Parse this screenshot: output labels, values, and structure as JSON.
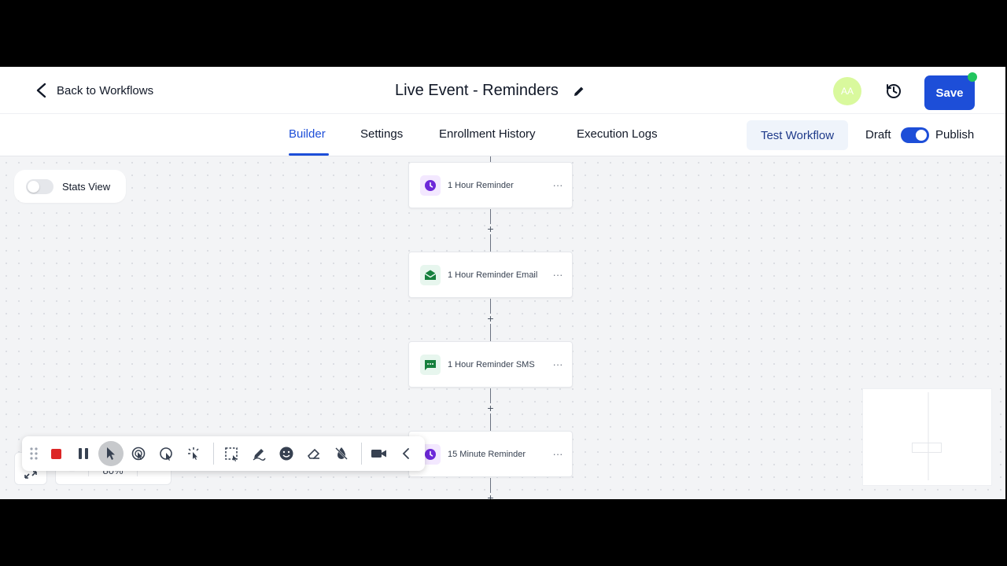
{
  "header": {
    "back_label": "Back to Workflows",
    "title": "Live Event - Reminders",
    "avatar_initials": "AA",
    "save_label": "Save"
  },
  "tabs": [
    {
      "label": "Builder",
      "active": true
    },
    {
      "label": "Settings",
      "active": false
    },
    {
      "label": "Enrollment History",
      "active": false
    },
    {
      "label": "Execution Logs",
      "active": false
    }
  ],
  "actions": {
    "test_label": "Test Workflow",
    "draft_label": "Draft",
    "publish_label": "Publish",
    "publish_on": true
  },
  "canvas": {
    "stats_label": "Stats View",
    "nodes": [
      {
        "label": "1 Hour Reminder",
        "icon": "clock-icon"
      },
      {
        "label": "1 Hour Reminder Email",
        "icon": "email-icon"
      },
      {
        "label": "1 Hour Reminder SMS",
        "icon": "sms-icon"
      },
      {
        "label": "15 Minute Reminder",
        "icon": "clock-icon"
      }
    ],
    "more_glyph": "···",
    "plus_glyph": "+"
  },
  "zoom": {
    "value_partial": "80%"
  },
  "colors": {
    "accent": "#1d4ed8",
    "wait_icon": "#6d28d9",
    "message_icon": "#15803d",
    "online_dot": "#22c55e"
  }
}
